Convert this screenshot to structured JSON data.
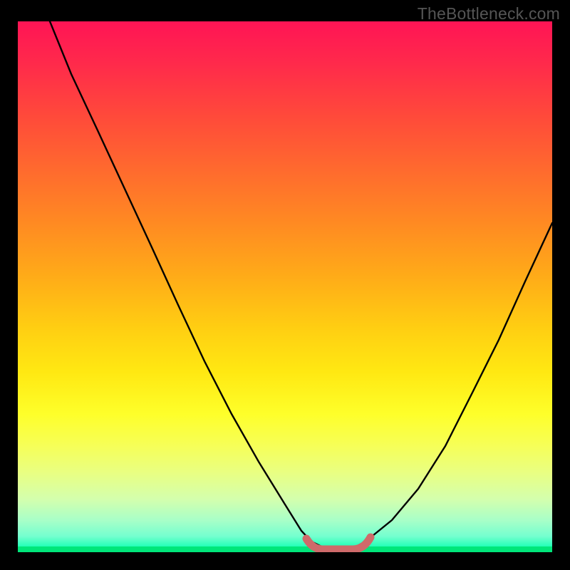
{
  "watermark": "TheBottleneck.com",
  "colors": {
    "frame": "#000000",
    "watermark_text": "#555555",
    "curve_stroke": "#000000",
    "bottom_marker": "#cf6a6a",
    "gradient_top": "#ff1455",
    "gradient_bottom": "#00ff98"
  },
  "chart_data": {
    "type": "line",
    "title": "",
    "xlabel": "",
    "ylabel": "",
    "xlim": [
      0,
      100
    ],
    "ylim": [
      0,
      100
    ],
    "grid": false,
    "legend": false,
    "series": [
      {
        "name": "bottleneck-curve",
        "x": [
          6,
          10,
          15,
          20,
          25,
          30,
          35,
          40,
          45,
          50,
          53,
          55,
          57,
          60,
          63,
          65,
          70,
          75,
          80,
          85,
          90,
          95,
          100
        ],
        "y": [
          100,
          90,
          79,
          68,
          57,
          46,
          36,
          26,
          17,
          9,
          4,
          2,
          1,
          1,
          1,
          2,
          6,
          12,
          20,
          30,
          40,
          51,
          62
        ]
      }
    ],
    "annotations": [
      {
        "name": "bottom-flat-region",
        "x_range": [
          55,
          65
        ],
        "y": 1,
        "color": "#cf6a6a"
      }
    ],
    "background": "vertical-gradient red→green"
  }
}
